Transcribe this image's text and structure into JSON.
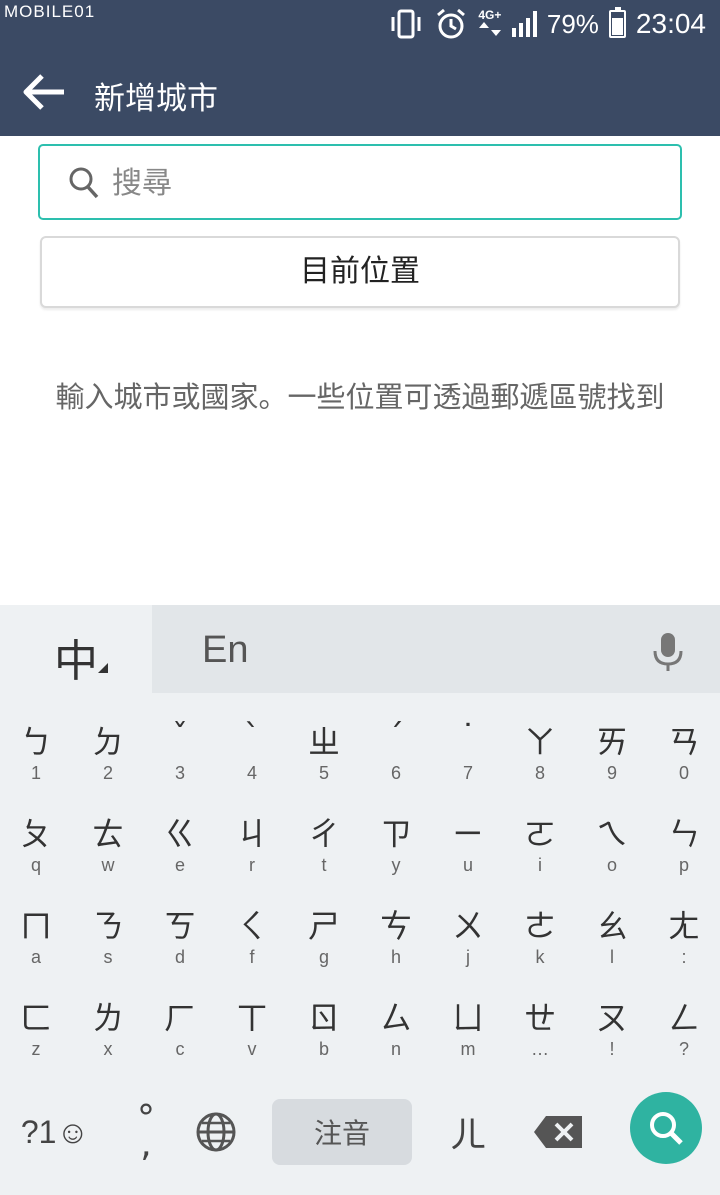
{
  "status_bar": {
    "brand": "MOBILE01",
    "network": "4G+",
    "battery_percent": "79%",
    "battery_level": 0.79,
    "time": "23:04"
  },
  "app_bar": {
    "title": "新增城市"
  },
  "search": {
    "placeholder": "搜尋",
    "value": ""
  },
  "current_location_label": "目前位置",
  "hint": "輸入城市或國家。一些位置可透過郵遞區號找到",
  "keyboard": {
    "lang_chinese": "中",
    "lang_english": "En",
    "rows": [
      [
        [
          "ㄅ",
          "1"
        ],
        [
          "ㄉ",
          "2"
        ],
        [
          "ˇ",
          "3"
        ],
        [
          "ˋ",
          "4"
        ],
        [
          "ㄓ",
          "5"
        ],
        [
          "ˊ",
          "6"
        ],
        [
          "˙",
          "7"
        ],
        [
          "ㄚ",
          "8"
        ],
        [
          "ㄞ",
          "9"
        ],
        [
          "ㄢ",
          "0"
        ]
      ],
      [
        [
          "ㄆ",
          "q"
        ],
        [
          "ㄊ",
          "w"
        ],
        [
          "ㄍ",
          "e"
        ],
        [
          "ㄐ",
          "r"
        ],
        [
          "ㄔ",
          "t"
        ],
        [
          "ㄗ",
          "y"
        ],
        [
          "ㄧ",
          "u"
        ],
        [
          "ㄛ",
          "i"
        ],
        [
          "ㄟ",
          "o"
        ],
        [
          "ㄣ",
          "p"
        ]
      ],
      [
        [
          "ㄇ",
          "a"
        ],
        [
          "ㄋ",
          "s"
        ],
        [
          "ㄎ",
          "d"
        ],
        [
          "ㄑ",
          "f"
        ],
        [
          "ㄕ",
          "g"
        ],
        [
          "ㄘ",
          "h"
        ],
        [
          "ㄨ",
          "j"
        ],
        [
          "ㄜ",
          "k"
        ],
        [
          "ㄠ",
          "l"
        ],
        [
          "ㄤ",
          ":"
        ]
      ],
      [
        [
          "ㄈ",
          "z"
        ],
        [
          "ㄌ",
          "x"
        ],
        [
          "ㄏ",
          "c"
        ],
        [
          "ㄒ",
          "v"
        ],
        [
          "ㄖ",
          "b"
        ],
        [
          "ㄙ",
          "n"
        ],
        [
          "ㄩ",
          "m"
        ],
        [
          "ㄝ",
          "…"
        ],
        [
          "ㄡ",
          "!"
        ],
        [
          "ㄥ",
          "?"
        ]
      ]
    ],
    "symbols_label": "?1☺",
    "punct_main": "°",
    "punct_sub": ",",
    "space_label": "注音",
    "er_key": "ㄦ"
  },
  "colors": {
    "app_bar": "#3b4a64",
    "accent": "#2dbfae",
    "keyboard_bg": "#eef1f3"
  }
}
